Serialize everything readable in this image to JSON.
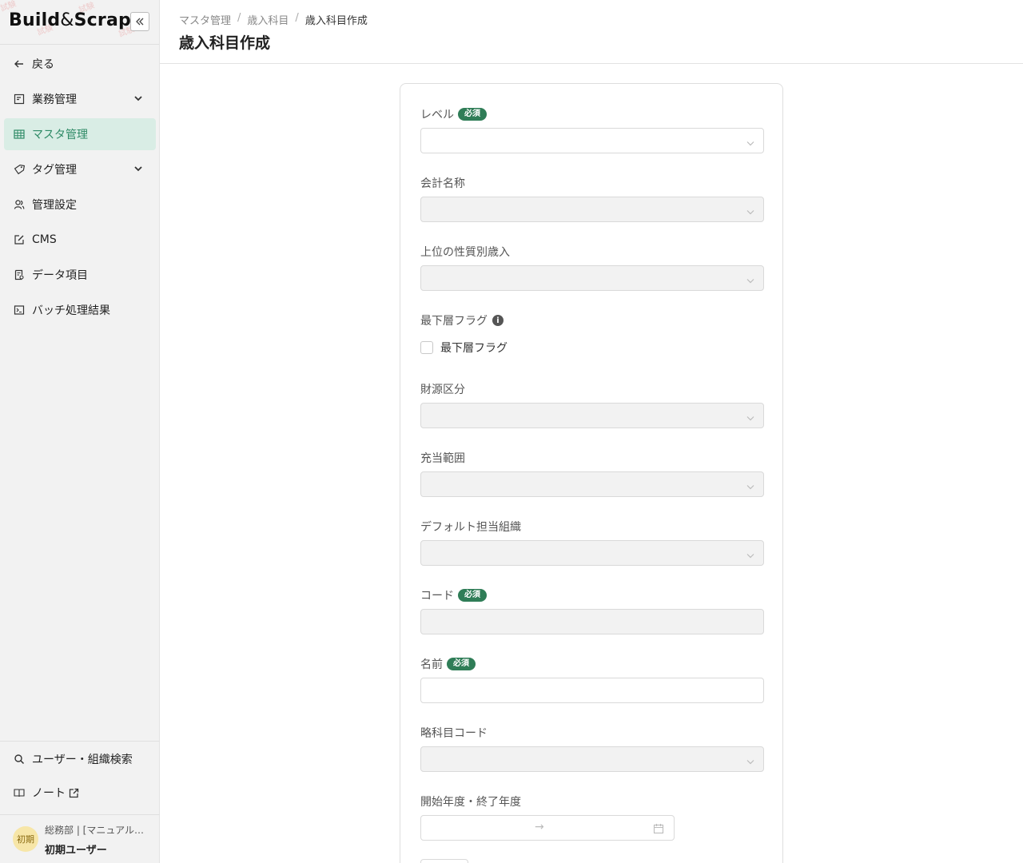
{
  "app": {
    "logo_main": "Build",
    "logo_amp": "&",
    "logo_tail": "Scrap"
  },
  "sidebar": {
    "back_label": "戻る",
    "items": [
      {
        "label": "業務管理",
        "icon": "document-box-icon",
        "expandable": true
      },
      {
        "label": "マスタ管理",
        "icon": "table-grid-icon",
        "active": true
      },
      {
        "label": "タグ管理",
        "icon": "tag-icon",
        "expandable": true
      },
      {
        "label": "管理設定",
        "icon": "users-icon"
      },
      {
        "label": "CMS",
        "icon": "edit-square-icon"
      },
      {
        "label": "データ項目",
        "icon": "data-sheet-icon"
      },
      {
        "label": "バッチ処理結果",
        "icon": "terminal-icon"
      }
    ],
    "bottom": {
      "search_label": "ユーザー・組織検索",
      "note_label": "ノート"
    },
    "user": {
      "avatar_text": "初期",
      "dept": "総務部 | [マニュアル…",
      "name": "初期ユーザー"
    }
  },
  "header": {
    "breadcrumb": [
      "マスタ管理",
      "歳入科目",
      "歳入科目作成"
    ],
    "separator": "/",
    "title": "歳入科目作成"
  },
  "form": {
    "required_badge": "必須",
    "fields": {
      "level": "レベル",
      "account_name": "会計名称",
      "parent_revenue": "上位の性質別歳入",
      "lowest_flag": "最下層フラグ",
      "lowest_flag_checkbox": "最下層フラグ",
      "funding_class": "財源区分",
      "allocation_range": "充当範囲",
      "default_org": "デフォルト担当組織",
      "code": "コード",
      "name": "名前",
      "short_code": "略科目コード",
      "fiscal_years": "開始年度・終了年度"
    },
    "range_separator": "→"
  },
  "colors": {
    "accent": "#2f7d57",
    "active_bg": "#d9ede5",
    "sidebar_bg": "#f2f2f2"
  }
}
